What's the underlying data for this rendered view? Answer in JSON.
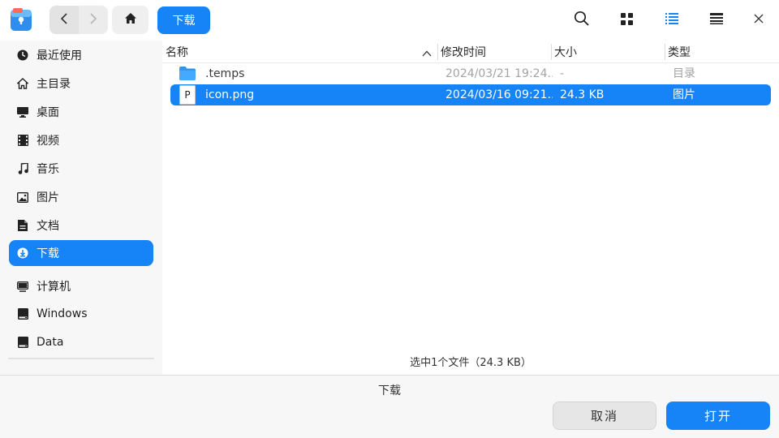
{
  "toolbar": {
    "breadcrumb_label": "下载",
    "icons": [
      "back-icon",
      "forward-icon",
      "home-icon",
      "search-icon",
      "icon-view-icon",
      "list-view-icon",
      "details-view-icon",
      "close-icon"
    ]
  },
  "sidebar": {
    "items": [
      {
        "label": "最近使用",
        "icon": "clock-icon"
      },
      {
        "label": "主目录",
        "icon": "home-icon"
      },
      {
        "label": "桌面",
        "icon": "desktop-icon"
      },
      {
        "label": "视频",
        "icon": "film-icon"
      },
      {
        "label": "音乐",
        "icon": "music-icon"
      },
      {
        "label": "图片",
        "icon": "image-icon"
      },
      {
        "label": "文档",
        "icon": "document-icon"
      },
      {
        "label": "下载",
        "icon": "download-icon",
        "active": true
      },
      {
        "label": "计算机",
        "icon": "computer-icon"
      },
      {
        "label": "Windows",
        "icon": "disk-icon"
      },
      {
        "label": "Data",
        "icon": "disk-icon"
      }
    ]
  },
  "file_list": {
    "columns": [
      "名称",
      "修改时间",
      "大小",
      "类型"
    ],
    "rows": [
      {
        "name": ".temps",
        "modified": "2024/03/21 19:24...",
        "size": "-",
        "type": "目录",
        "icon": "folder-icon",
        "selected": false
      },
      {
        "name": "icon.png",
        "modified": "2024/03/16 09:21...",
        "size": "24.3 KB",
        "type": "图片",
        "icon": "image-file-icon",
        "file_letter": "P",
        "selected": true
      }
    ],
    "status": "选中1个文件（24.3 KB）"
  },
  "footer": {
    "current_dir": "下载",
    "cancel_label": "取消",
    "open_label": "打开"
  },
  "colors": {
    "accent": "#1683f7",
    "sidebar_bg": "#f7f7f7",
    "folder": "#2e97f0"
  }
}
